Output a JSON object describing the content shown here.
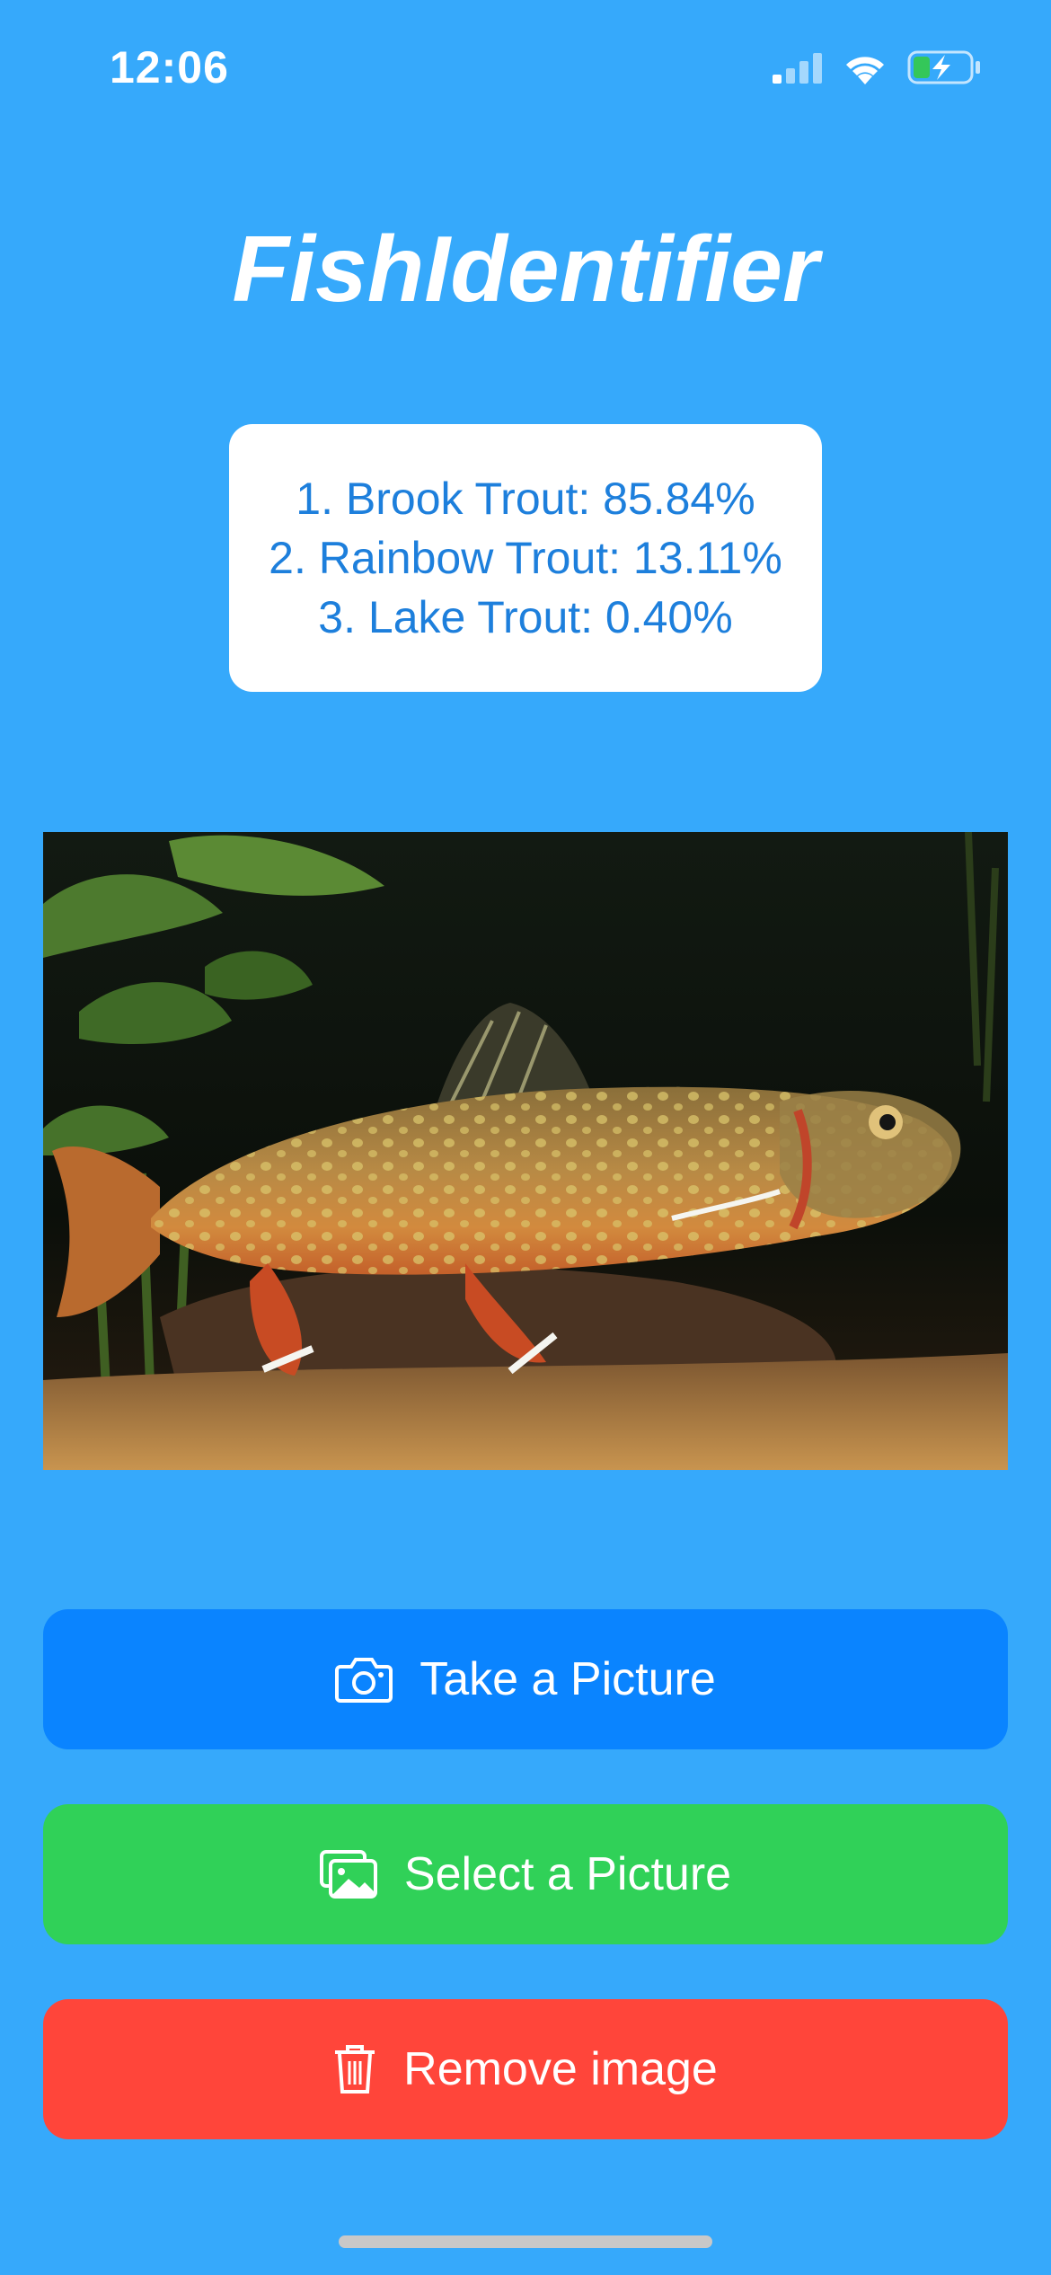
{
  "status_bar": {
    "time": "12:06",
    "icons": [
      "cellular-signal-icon",
      "wifi-icon",
      "battery-charging-icon"
    ]
  },
  "app": {
    "title": "FishIdentifier"
  },
  "results": [
    "1. Brook Trout: 85.84%",
    "2. Rainbow Trout: 13.11%",
    "3. Lake Trout: 0.40%"
  ],
  "buttons": {
    "take": {
      "label": "Take a Picture",
      "icon": "camera-icon",
      "color": "#0a84ff"
    },
    "select": {
      "label": "Select a Picture",
      "icon": "photo-library-icon",
      "color": "#30d158"
    },
    "remove": {
      "label": "Remove image",
      "icon": "trash-icon",
      "color": "#ff453a"
    }
  },
  "colors": {
    "background": "#36a9fb",
    "results_text": "#1d7fdc"
  }
}
